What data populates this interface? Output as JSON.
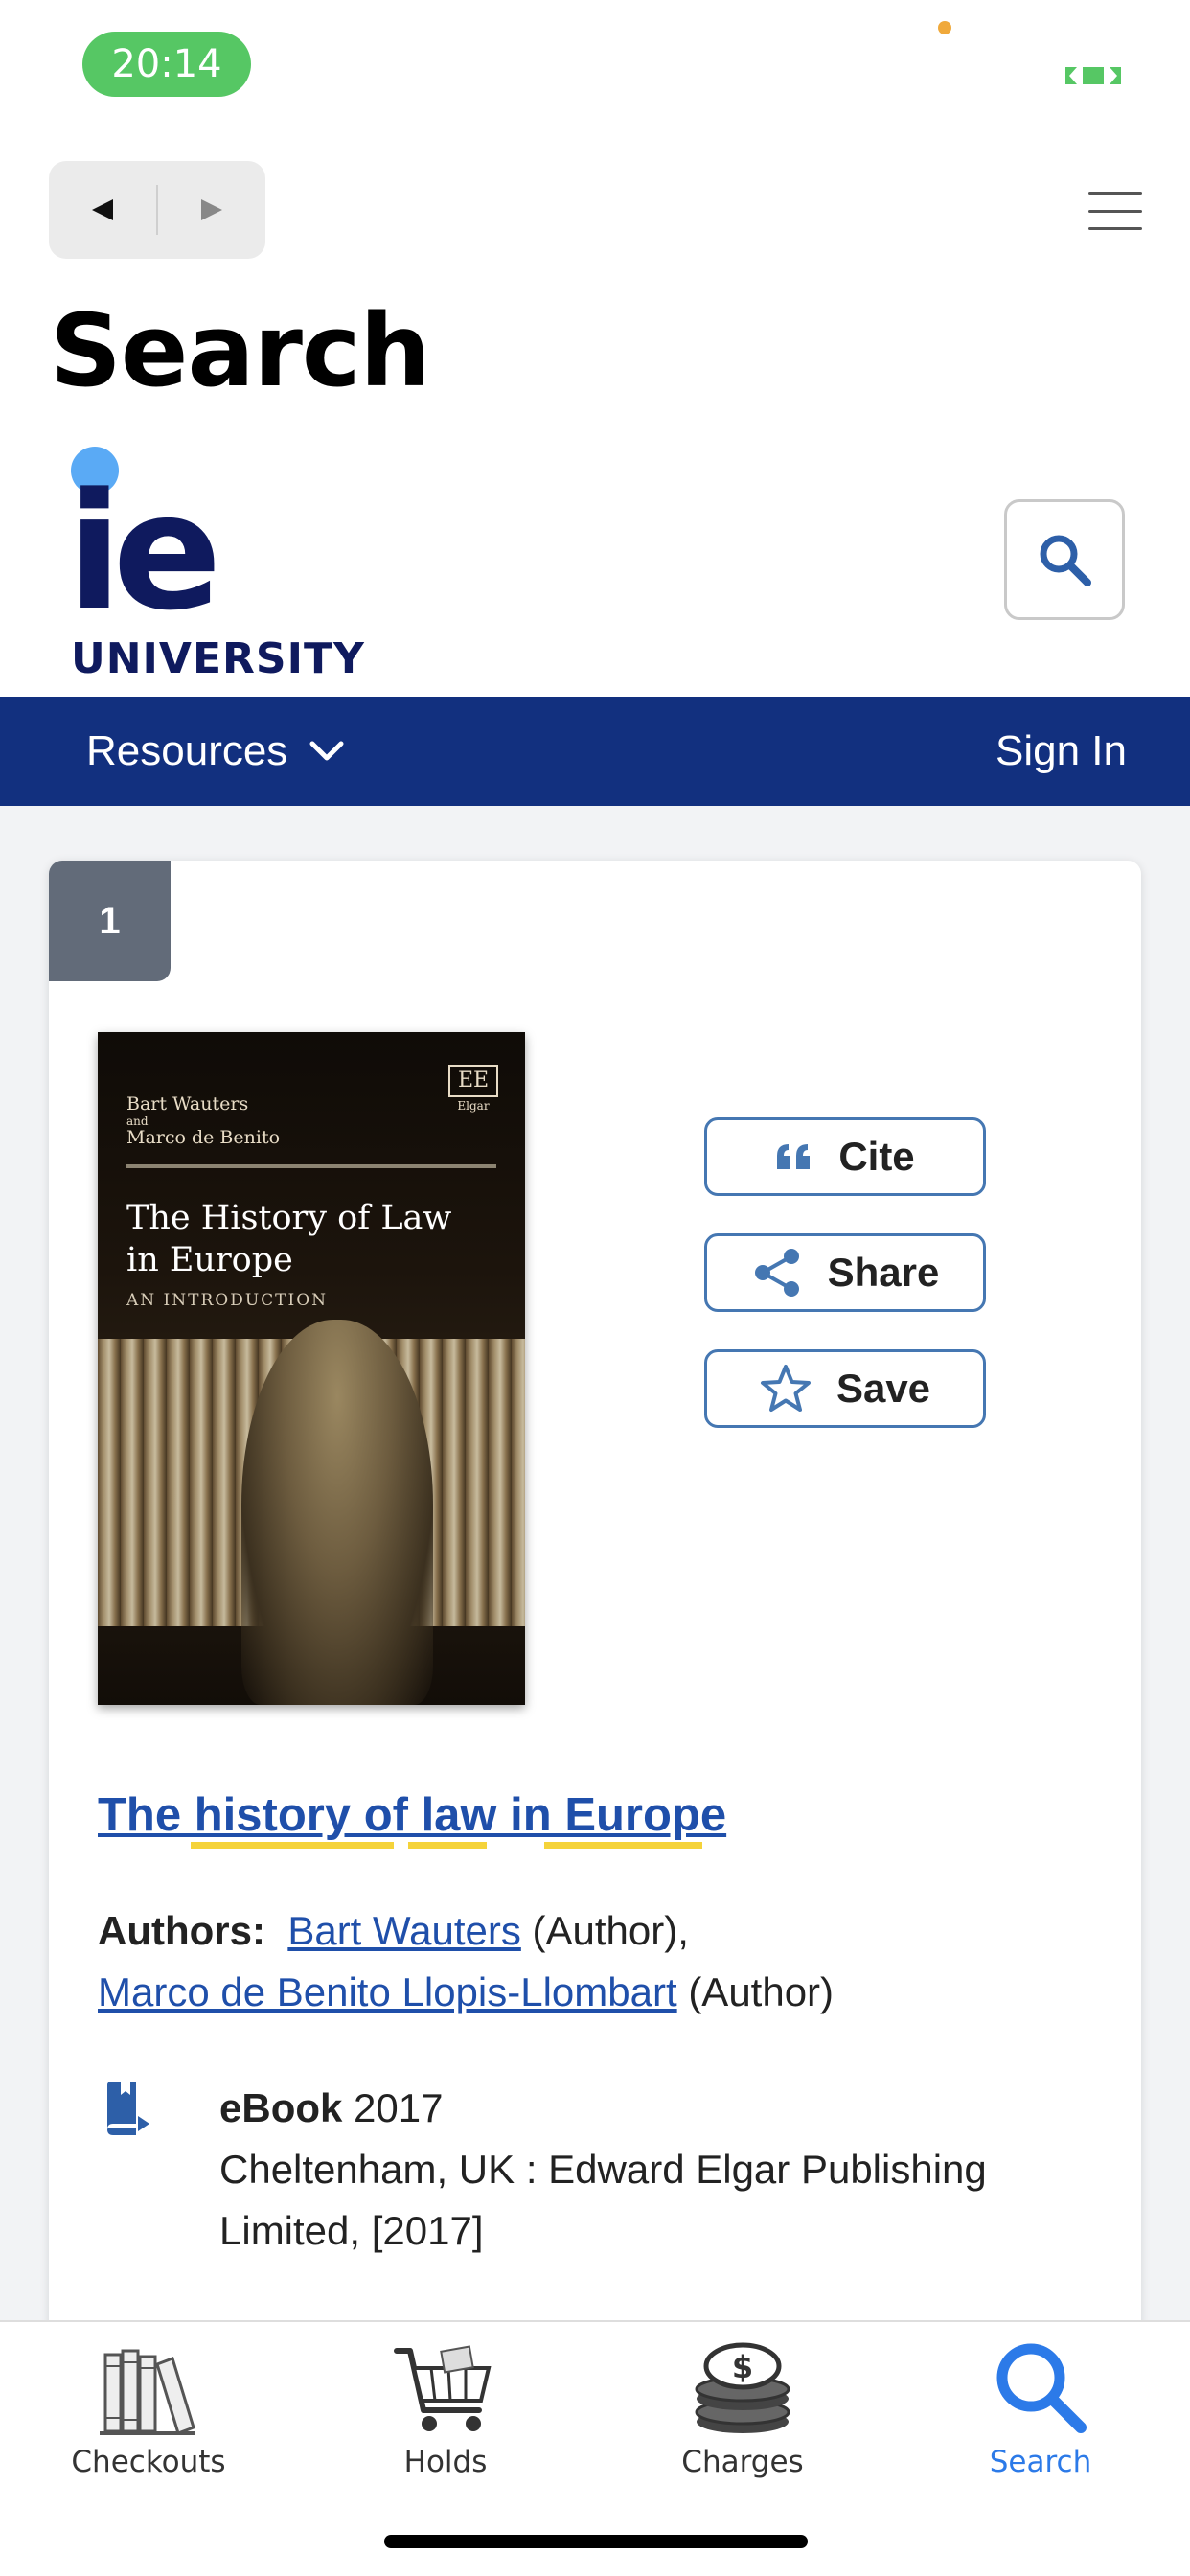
{
  "status_bar": {
    "time": "20:14"
  },
  "page": {
    "title": "Search"
  },
  "logo": {
    "mark": "ie",
    "word": "UNIVERSITY"
  },
  "nav": {
    "resources": "Resources",
    "sign_in": "Sign In"
  },
  "result": {
    "index": "1",
    "cover": {
      "authors_line1": "Bart Wauters",
      "authors_and": "and",
      "authors_line2": "Marco de Benito",
      "title_line1": "The History of Law",
      "title_line2": "in Europe",
      "subtitle": "AN INTRODUCTION",
      "publisher_mark": "EE",
      "publisher_name": "Elgar"
    },
    "actions": {
      "cite": "Cite",
      "share": "Share",
      "save": "Save"
    },
    "title": "The history of law in Europe",
    "authors_label": "Authors:",
    "author1": "Bart Wauters",
    "author1_role": "(Author),",
    "author2": "Marco de Benito Llopis-Llombart",
    "author2_role": "(Author)",
    "format": "eBook",
    "year": "2017",
    "publisher": "Cheltenham, UK : Edward Elgar Publishing Limited, [2017]"
  },
  "tabs": [
    {
      "label": "Checkouts",
      "icon": "books-icon"
    },
    {
      "label": "Holds",
      "icon": "cart-icon"
    },
    {
      "label": "Charges",
      "icon": "coins-icon"
    },
    {
      "label": "Search",
      "icon": "search-icon"
    }
  ],
  "colors": {
    "accent": "#2c7ae8",
    "nav_bar": "#12307f",
    "link": "#1f4faa",
    "highlight": "#f5d33a"
  }
}
